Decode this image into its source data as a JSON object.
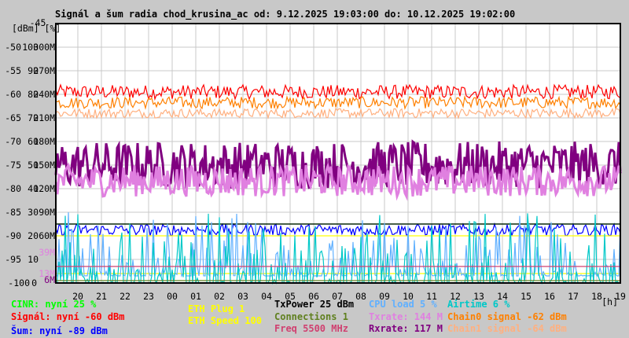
{
  "title": "Signál a šum radia chod_krusina_ac od: 9.12.2025 19:03:00 do: 10.12.2025 19:02:00",
  "chart_data": {
    "type": "line",
    "title": "Signál a šum radia chod_krusina_ac od: 9.12.2025 19:03:00 do: 10.12.2025 19:02:00",
    "ylabel": "[dBm] [%]",
    "xlabel": "[h]",
    "x_ticks": [
      "20",
      "21",
      "22",
      "23",
      "00",
      "01",
      "02",
      "03",
      "04",
      "05",
      "06",
      "07",
      "08",
      "09",
      "10",
      "11",
      "12",
      "13",
      "14",
      "15",
      "16",
      "17",
      "18",
      "19"
    ],
    "y_ticks_dbm": [
      "-45",
      "-50",
      "-55",
      "-60",
      "-65",
      "-70",
      "-75",
      "-80",
      "-85",
      "-90",
      "-95",
      "-100"
    ],
    "y_ticks_pct": [
      "100",
      "90",
      "80",
      "70",
      "60",
      "50",
      "40",
      "30",
      "20",
      "10",
      "0"
    ],
    "y_ticks_rate": [
      "300M",
      "270M",
      "240M",
      "210M",
      "180M",
      "150M",
      "120M",
      "90M",
      "60M"
    ],
    "extra_rate_ticks": [
      {
        "label": "39M",
        "color": "#e080e0"
      },
      {
        "label": "13M",
        "color": "#e080e0"
      },
      {
        "label": "6M",
        "color": "#800080"
      }
    ],
    "ylim_dbm": [
      -100,
      -45
    ],
    "ylim_pct": [
      0,
      110
    ],
    "ylim_rate": [
      0,
      330
    ],
    "grid": true,
    "series": [
      {
        "name": "Signál",
        "axis": "dBm",
        "typical": -60,
        "range": [
          -61,
          -58
        ],
        "color": "#ff0000"
      },
      {
        "name": "Chain0 signal",
        "axis": "dBm",
        "typical": -62,
        "range": [
          -63,
          -60.5
        ],
        "color": "#ff8000"
      },
      {
        "name": "Chain1 signal",
        "axis": "dBm",
        "typical": -64,
        "range": [
          -65,
          -63
        ],
        "color": "#ffb080"
      },
      {
        "name": "Rxrate",
        "axis": "rate",
        "typical": 150,
        "range": [
          120,
          180
        ],
        "color": "#800080"
      },
      {
        "name": "Txrate",
        "axis": "rate",
        "typical": 130,
        "range": [
          110,
          150
        ],
        "color": "#e080e0"
      },
      {
        "name": "Šum",
        "axis": "dBm",
        "typical": -89,
        "range": [
          -90,
          -87.5
        ],
        "color": "#0000ff"
      },
      {
        "name": "CINR",
        "axis": "pct",
        "typical": 25,
        "color": "#00ff00"
      },
      {
        "name": "TxPower",
        "axis": "pct",
        "typical": 25,
        "color": "#000000"
      },
      {
        "name": "ETH Speed",
        "axis": "rate",
        "typical": 60,
        "color": "#ffff00"
      },
      {
        "name": "ETH Plug",
        "axis": "pct",
        "typical": 4,
        "color": "#ffff00"
      },
      {
        "name": "CPU load",
        "axis": "pct",
        "typical": 5,
        "range": [
          3,
          30
        ],
        "color": "#60b0ff"
      },
      {
        "name": "Airtime",
        "axis": "pct",
        "typical": 2,
        "range": [
          0,
          30
        ],
        "color": "#00c8c8"
      },
      {
        "name": "Freq",
        "axis": "pct",
        "typical": 7,
        "color": "#d04070"
      },
      {
        "name": "Connections",
        "axis": "pct",
        "typical": 1,
        "color": "#608020"
      }
    ]
  },
  "legend": {
    "cinr": {
      "text": "CINR: nyní 25 %",
      "color": "#00ff00"
    },
    "signal": {
      "text": "Signál: nyní -60 dBm",
      "color": "#ff0000"
    },
    "noise": {
      "text": "Šum: nyní -89 dBm",
      "color": "#0000ff"
    },
    "eth_plug": {
      "text": "ETH Plug 1",
      "color": "#ffff00"
    },
    "eth_speed": {
      "text": "ETH Speed 100",
      "color": "#ffff00"
    },
    "txpower": {
      "text": "TxPower 25 dBm",
      "color": "#000000"
    },
    "connections": {
      "text": "Connections 1",
      "color": "#608020"
    },
    "freq": {
      "text": "Freq 5500 MHz",
      "color": "#d04070"
    },
    "cpu": {
      "text": "CPU load 5 %",
      "color": "#60b0ff"
    },
    "txrate": {
      "text": "Txrate: 144 M",
      "color": "#e080e0"
    },
    "rxrate": {
      "text": "Rxrate: 117 M",
      "color": "#800080"
    },
    "airtime": {
      "text": "Airtime 6 %",
      "color": "#00c8c8"
    },
    "chain0": {
      "text": "Chain0 signal -62 dBm",
      "color": "#ff8000"
    },
    "chain1": {
      "text": "Chain1 signal -64 dBm",
      "color": "#ffb080"
    }
  }
}
